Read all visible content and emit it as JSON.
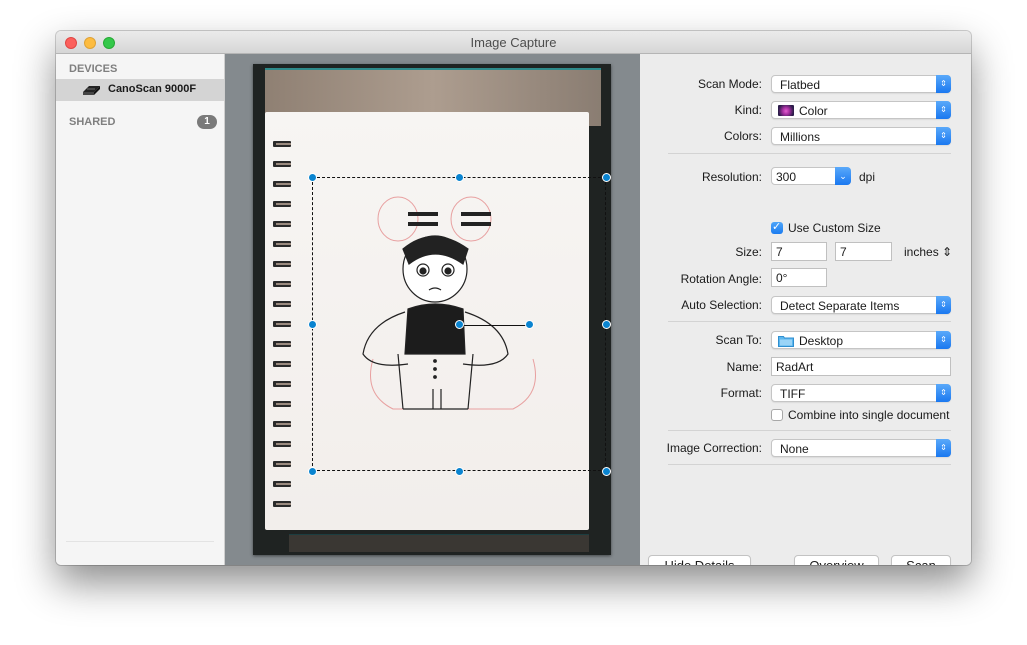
{
  "window": {
    "title": "Image Capture"
  },
  "sidebar": {
    "devices_header": "DEVICES",
    "devices": [
      {
        "name": "CanoScan 9000F",
        "icon": "scanner-icon",
        "selected": true
      }
    ],
    "shared_header": "SHARED",
    "shared_count": "1"
  },
  "preview": {
    "selection_handles": 8,
    "rotation_handle": true
  },
  "details": {
    "scan_mode": {
      "label": "Scan Mode:",
      "value": "Flatbed"
    },
    "kind": {
      "label": "Kind:",
      "value": "Color",
      "icon": "color-flower-icon"
    },
    "colors": {
      "label": "Colors:",
      "value": "Millions"
    },
    "resolution": {
      "label": "Resolution:",
      "value": "300",
      "unit": "dpi"
    },
    "custom_size": {
      "label": "Use Custom Size",
      "checked": true
    },
    "size": {
      "label": "Size:",
      "width": "7",
      "height": "7",
      "unit": "inches"
    },
    "rotation": {
      "label": "Rotation Angle:",
      "value": "0°"
    },
    "auto_selection": {
      "label": "Auto Selection:",
      "value": "Detect Separate Items"
    },
    "scan_to": {
      "label": "Scan To:",
      "value": "Desktop",
      "icon": "folder-icon"
    },
    "name": {
      "label": "Name:",
      "value": "RadArt"
    },
    "format": {
      "label": "Format:",
      "value": "TIFF"
    },
    "combine": {
      "label": "Combine into single document",
      "checked": false
    },
    "image_correction": {
      "label": "Image Correction:",
      "value": "None"
    }
  },
  "buttons": {
    "hide_details": "Hide Details",
    "overview": "Overview",
    "scan": "Scan"
  },
  "colors": {
    "accent": "#1a78f0",
    "handle": "#0a84d0"
  }
}
